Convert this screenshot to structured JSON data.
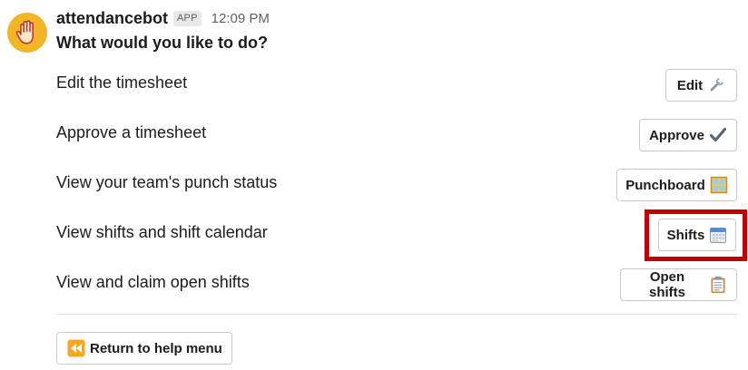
{
  "message": {
    "bot_name": "attendancebot",
    "badge": "APP",
    "timestamp": "12:09 PM",
    "question": "What would you like to do?",
    "avatar_icon": "raised-hand-icon",
    "avatar_color": "#f2b527"
  },
  "actions": [
    {
      "label": "Edit the timesheet",
      "button": "Edit",
      "icon": "wrench-icon"
    },
    {
      "label": "Approve a timesheet",
      "button": "Approve",
      "icon": "check-mark-icon"
    },
    {
      "label": "View your team's punch status",
      "button": "Punchboard",
      "icon": "window-icon"
    },
    {
      "label": "View shifts and shift calendar",
      "button": "Shifts",
      "icon": "calendar-icon"
    },
    {
      "label": "View and claim open shifts",
      "button": "Open shifts",
      "icon": "clipboard-icon"
    }
  ],
  "footer": {
    "return_button": "Return to help menu",
    "return_icon": "rewind-icon"
  },
  "highlight": {
    "target": "Shifts",
    "color": "#c00000"
  }
}
